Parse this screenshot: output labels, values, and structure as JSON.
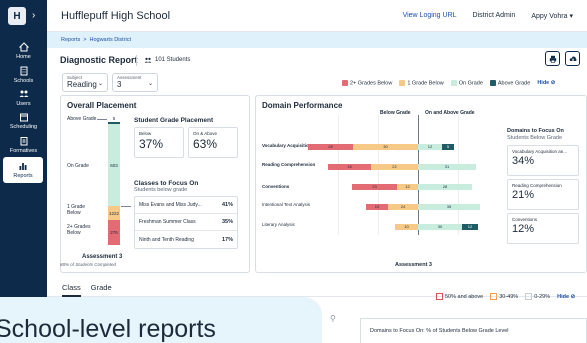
{
  "sidebar": {
    "logo": "H",
    "items": [
      {
        "label": "Home"
      },
      {
        "label": "Schools"
      },
      {
        "label": "Users"
      },
      {
        "label": "Scheduling"
      },
      {
        "label": "Formatives"
      },
      {
        "label": "Reports"
      }
    ]
  },
  "topbar": {
    "school": "Hufflepuff High School",
    "view_url": "View Loging URL",
    "role": "District Admin",
    "user": "Appy Vohra"
  },
  "breadcrumb": {
    "root": "Reports",
    "sep": ">",
    "current": "Hogwarts District"
  },
  "report": {
    "title": "Diagnostic Report",
    "students": "101 Students"
  },
  "filters": {
    "subject_label": "Subject",
    "subject_value": "Reading",
    "assessment_label": "Assessment",
    "assessment_value": "3"
  },
  "legend": {
    "two_below": "2+ Grades Below",
    "one_below": "1 Grade Below",
    "on_grade": "On Grade",
    "above": "Above Grade",
    "hide": "Hide",
    "colors": {
      "two_below": "#e36b73",
      "one_below": "#f7c986",
      "on_grade": "#c8ecde",
      "above": "#1f5c66"
    }
  },
  "overall": {
    "title": "Overall Placement",
    "labels": {
      "above": "Above Grade",
      "on": "On Grade",
      "one_below": "1 Grade Below",
      "two_below": "2+ Grades Below"
    },
    "values": {
      "above": "5",
      "on": "603",
      "one_below": "1222",
      "two_below": "276"
    },
    "sgp": {
      "title": "Student Grade Placement",
      "below_label": "Below",
      "below_pct": "37%",
      "on_above_label": "On & Above",
      "on_above_pct": "63%"
    },
    "classes": {
      "title": "Classes to Focus On",
      "subtitle": "Students below grade",
      "rows": [
        {
          "name": "Miss Evans and Miss Judy...",
          "pct": "41%"
        },
        {
          "name": "Freshman Summer Class",
          "pct": "35%"
        },
        {
          "name": "Ninth and Tenth Reading",
          "pct": "17%"
        }
      ]
    },
    "assessment": "Assessment 3",
    "completed": "88% of Students Completed"
  },
  "domain": {
    "title": "Domain Performance",
    "below_head": "Below Grade",
    "above_head": "On and Above Grade",
    "rows": [
      {
        "label": "Vocabulary Acquisition an...",
        "values": [
          "28",
          "30",
          "12",
          "5"
        ],
        "bold": true
      },
      {
        "label": "Reading Comprehension",
        "values": [
          "18",
          "22",
          "31",
          ""
        ],
        "bold": true
      },
      {
        "label": "Conventions",
        "values": [
          "23",
          "12",
          "28",
          ""
        ],
        "bold": true
      },
      {
        "label": "Intentional Text Analysis",
        "values": [
          "10",
          "24",
          "35",
          ""
        ],
        "bold": false
      },
      {
        "label": "Literary Analysis",
        "values": [
          "",
          "10",
          "30",
          "12"
        ],
        "bold": false
      }
    ],
    "assessment": "Assessment 3",
    "focus": {
      "title": "Domains to Focus On",
      "subtitle": "Students Below Grade",
      "items": [
        {
          "label": "Vocabulary Acquisition an...",
          "pct": "34%"
        },
        {
          "label": "Reading Comprehension",
          "pct": "21%"
        },
        {
          "label": "Conventions",
          "pct": "12%"
        }
      ]
    }
  },
  "tabs": {
    "class": "Class",
    "grade": "Grade"
  },
  "legend2": {
    "high": "50% and above",
    "mid": "30-49%",
    "low": "0-29%",
    "hide": "Hide"
  },
  "bottom": {
    "text": "Domains to Focus On: % of Students Below Grade Level"
  },
  "promo": {
    "text": "School-level reports"
  }
}
